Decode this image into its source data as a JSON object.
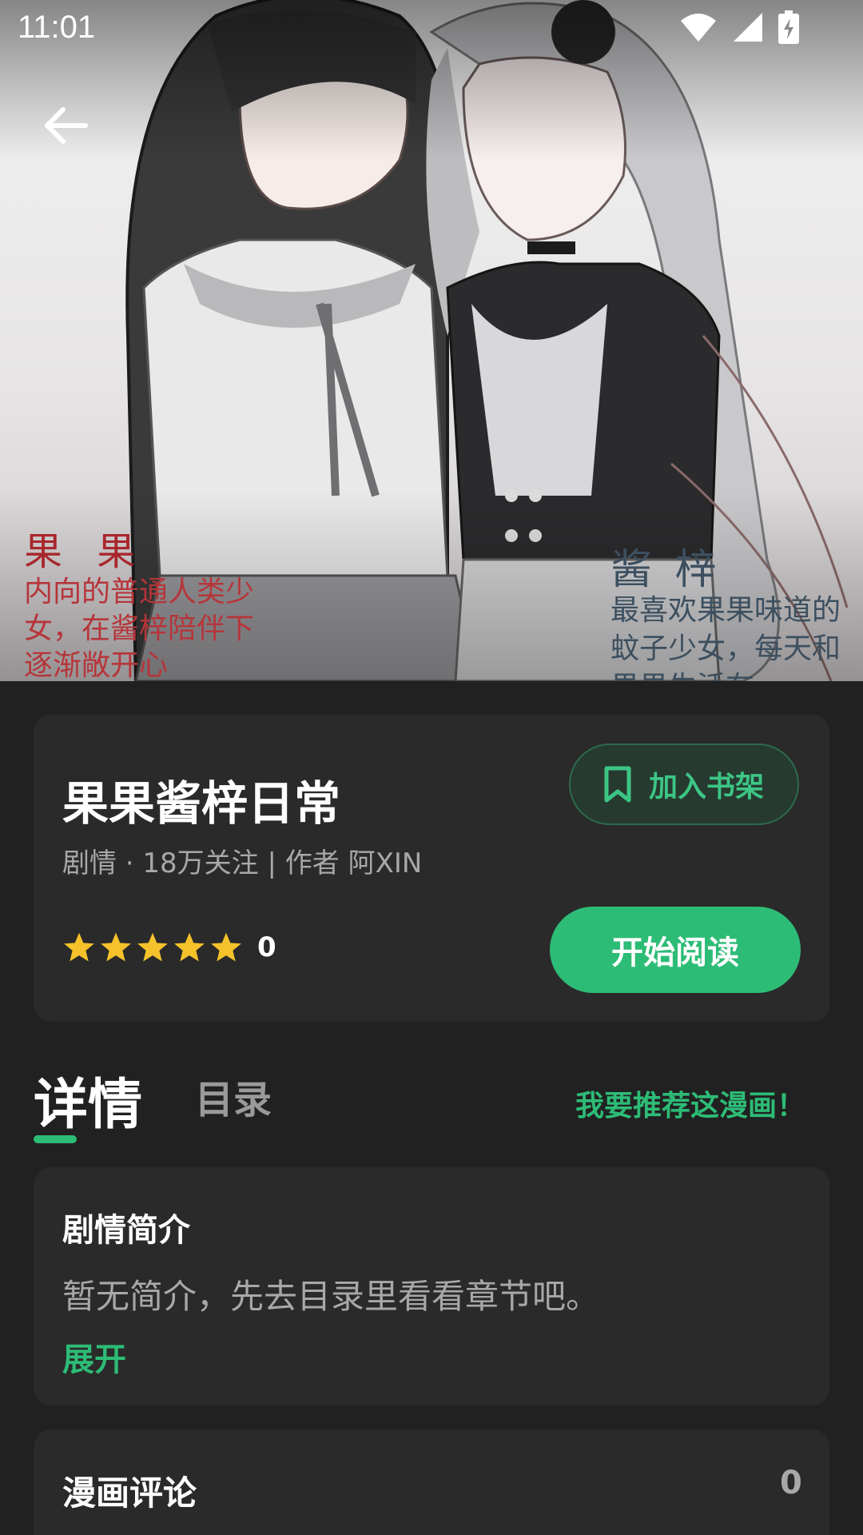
{
  "status_bar": {
    "time": "11:01"
  },
  "cover": {
    "left_caption": {
      "name": "果 果",
      "description": "内向的普通人类少女，在酱梓陪伴下逐渐敞开心"
    },
    "right_caption": {
      "name": "酱 梓",
      "description": "最喜欢果果味道的蚊子少女，每天和果果生活在"
    }
  },
  "comic": {
    "title": "果果酱梓日常",
    "meta": "剧情 · 18万关注 | 作者 阿XIN",
    "bookshelf_label": "加入书架",
    "rating_value": "0",
    "star_count": 5,
    "read_button": "开始阅读"
  },
  "tabs": {
    "detail": "详情",
    "toc": "目录",
    "recommend": "我要推荐这漫画！"
  },
  "synopsis": {
    "title": "剧情简介",
    "text": "暂无简介，先去目录里看看章节吧。",
    "expand": "展开"
  },
  "comments": {
    "title": "漫画评论",
    "count": "0"
  },
  "colors": {
    "accent": "#2dbc76",
    "background": "#212121",
    "card": "#2a2a2a",
    "star": "#f5c22b"
  }
}
